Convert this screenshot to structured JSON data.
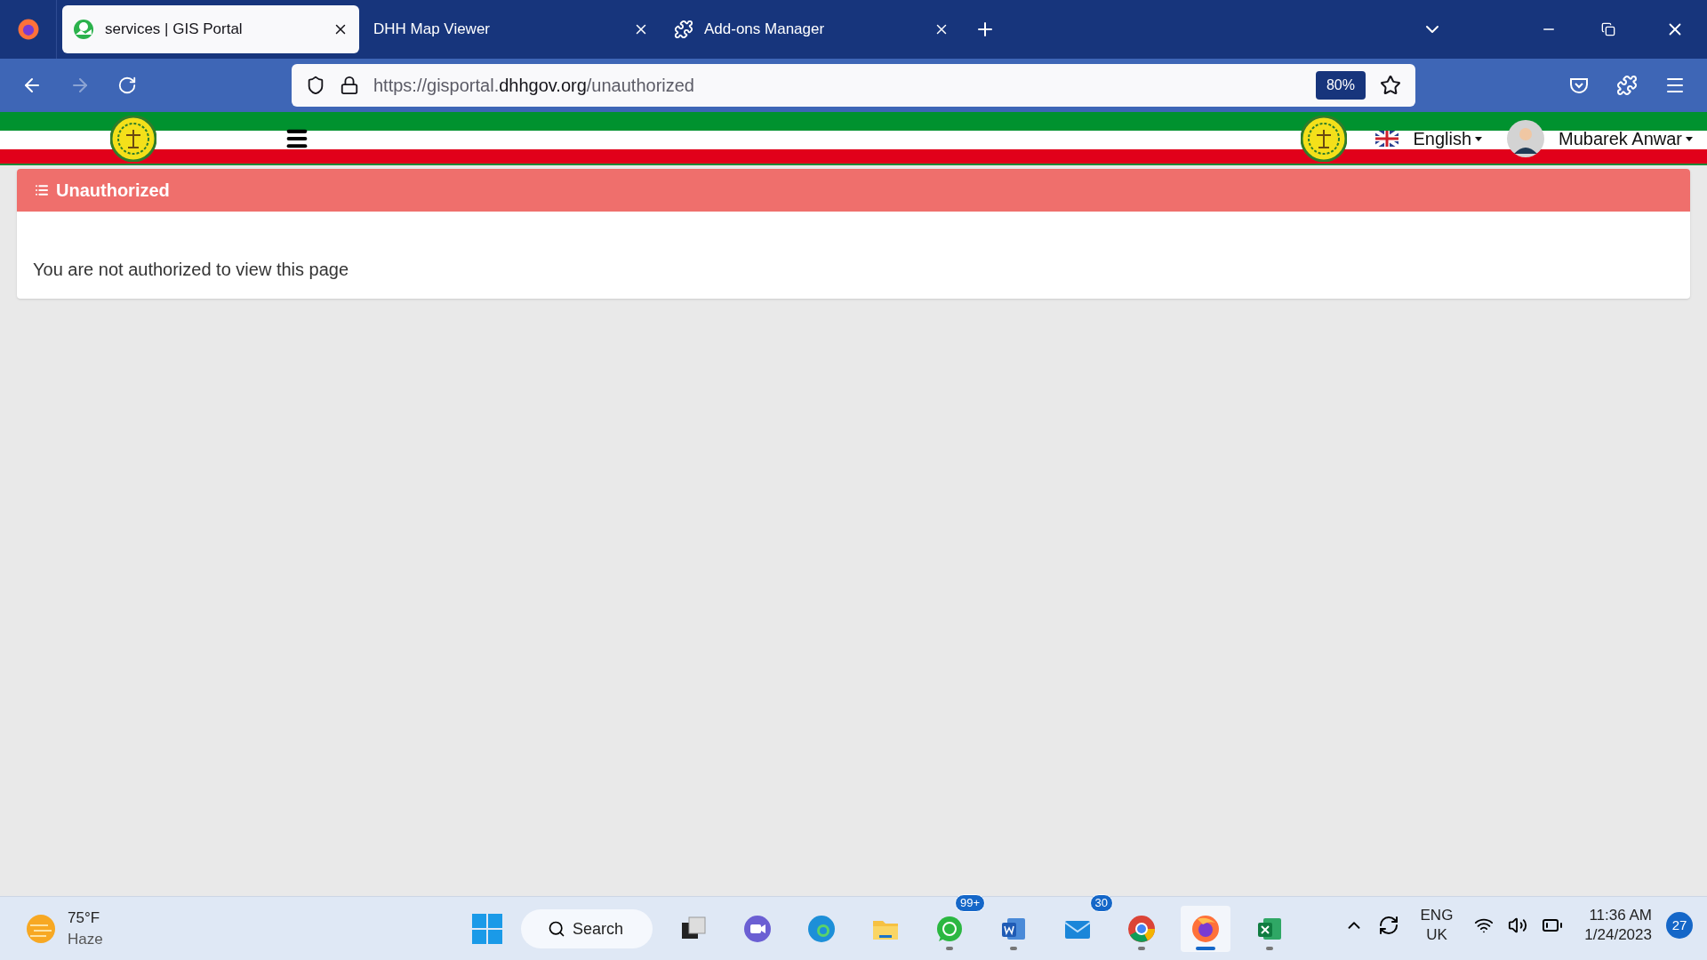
{
  "browser": {
    "tabs": [
      {
        "kind": "portal",
        "title": "services | GIS Portal",
        "selected": true
      },
      {
        "kind": "none",
        "title": "DHH Map Viewer",
        "selected": false
      },
      {
        "kind": "addons",
        "title": "Add-ons Manager",
        "selected": false
      }
    ],
    "url": {
      "prefix": "https://gisportal.",
      "domain": "dhhgov.org",
      "path": "/unauthorized"
    },
    "zoom": "80%"
  },
  "header": {
    "language": "English",
    "user": "Mubarek Anwar"
  },
  "card": {
    "title": "Unauthorized",
    "message": "You are not authorized to view this page"
  },
  "taskbar": {
    "weather": {
      "temp": "75°F",
      "condition": "Haze"
    },
    "search": "Search",
    "apps": [
      {
        "kind": "taskview",
        "running": false,
        "active": false
      },
      {
        "kind": "chat",
        "running": false,
        "active": false
      },
      {
        "kind": "edge",
        "running": false,
        "active": false
      },
      {
        "kind": "folder",
        "running": false,
        "active": false
      },
      {
        "kind": "whatsapp",
        "badge": "99+",
        "running": true,
        "active": false
      },
      {
        "kind": "word",
        "running": true,
        "active": false
      },
      {
        "kind": "mail",
        "badge": "30",
        "running": false,
        "active": false
      },
      {
        "kind": "chrome",
        "running": true,
        "active": false
      },
      {
        "kind": "firefox",
        "running": true,
        "active": true
      },
      {
        "kind": "excel",
        "running": true,
        "active": false
      }
    ],
    "tray": {
      "lang": "ENG",
      "region": "UK",
      "time": "11:36 AM",
      "date": "1/24/2023",
      "notifications": "27"
    }
  }
}
